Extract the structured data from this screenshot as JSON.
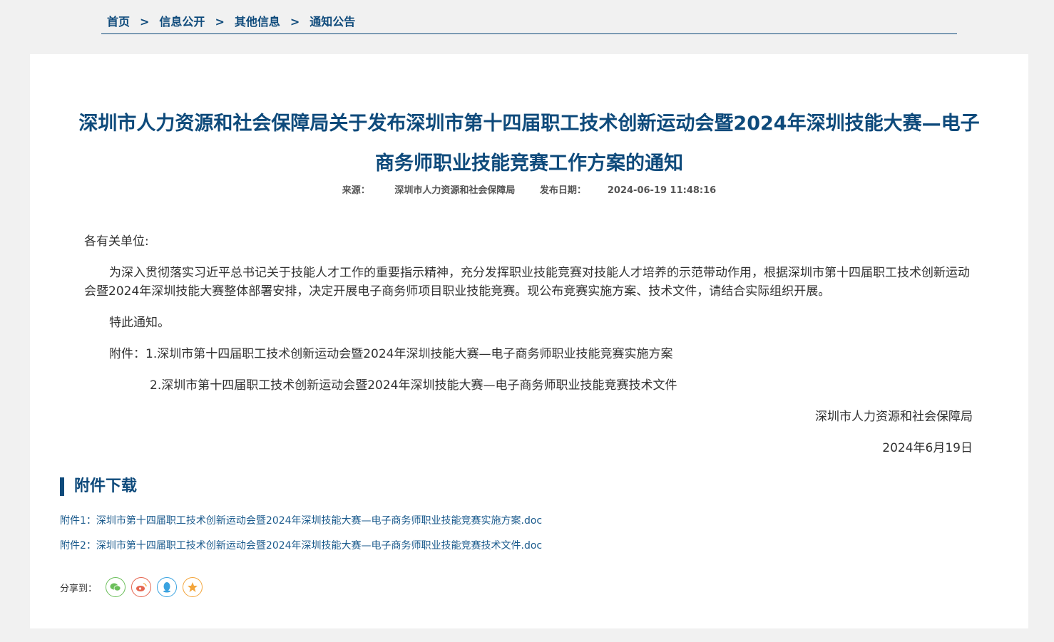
{
  "breadcrumb": {
    "items": [
      "首页",
      "信息公开",
      "其他信息",
      "通知公告"
    ],
    "separator": ">"
  },
  "article": {
    "title": "深圳市人力资源和社会保障局关于发布深圳市第十四届职工技术创新运动会暨2024年深圳技能大赛—电子商务师职业技能竞赛工作方案的通知",
    "source_label": "来源：",
    "source": "深圳市人力资源和社会保障局",
    "date_label": "发布日期：",
    "date": "2024-06-19 11:48:16",
    "salutation": "各有关单位:",
    "body": "为深入贯彻落实习近平总书记关于技能人才工作的重要指示精神，充分发挥职业技能竞赛对技能人才培养的示范带动作用，根据深圳市第十四届职工技术创新运动会暨2024年深圳技能大赛整体部署安排，决定开展电子商务师项目职业技能竞赛。现公布竞赛实施方案、技术文件，请结合实际组织开展。",
    "notice": "特此通知。",
    "attachment_line1": "附件：1.深圳市第十四届职工技术创新运动会暨2024年深圳技能大赛—电子商务师职业技能竞赛实施方案",
    "attachment_line2": "2.深圳市第十四届职工技术创新运动会暨2024年深圳技能大赛—电子商务师职业技能竞赛技术文件",
    "signature": "深圳市人力资源和社会保障局",
    "sign_date": "2024年6月19日"
  },
  "attachments": {
    "title": "附件下载",
    "links": [
      "附件1：深圳市第十四届职工技术创新运动会暨2024年深圳技能大赛—电子商务师职业技能竞赛实施方案.doc",
      "附件2：深圳市第十四届职工技术创新运动会暨2024年深圳技能大赛—电子商务师职业技能竞赛技术文件.doc"
    ]
  },
  "share": {
    "label": "分享到：",
    "icons": [
      {
        "name": "wechat-icon",
        "color": "#6bbf5a"
      },
      {
        "name": "weibo-icon",
        "color": "#e5654f"
      },
      {
        "name": "qq-icon",
        "color": "#3aa3e0"
      },
      {
        "name": "favorite-icon",
        "color": "#f3a53b"
      }
    ]
  }
}
